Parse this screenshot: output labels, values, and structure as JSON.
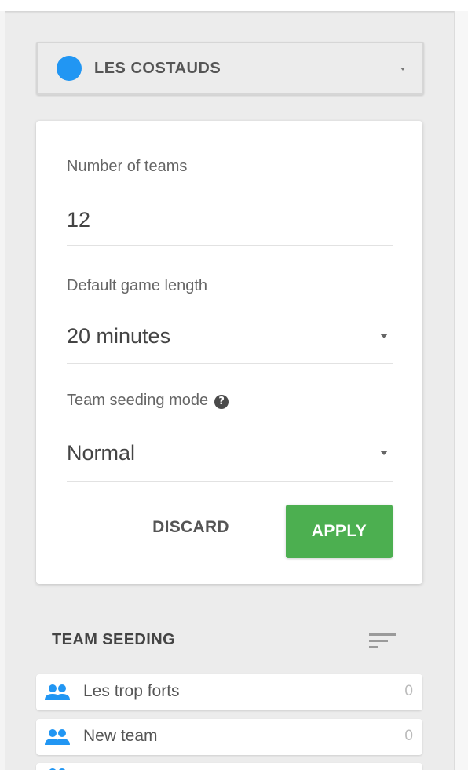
{
  "group_selector": {
    "name": "LES COSTAUDS",
    "color": "#2196f3"
  },
  "settings": {
    "num_teams": {
      "label": "Number of teams",
      "value": "12"
    },
    "game_length": {
      "label": "Default game length",
      "value": "20 minutes"
    },
    "seeding_mode": {
      "label": "Team seeding mode",
      "value": "Normal",
      "help_icon": "help-icon"
    },
    "discard_label": "DISCARD",
    "apply_label": "APPLY",
    "apply_color": "#4caf50"
  },
  "team_seeding": {
    "title": "TEAM SEEDING",
    "sort_icon": "sort-icon",
    "teams": [
      {
        "name": "Les trop forts",
        "score": "0",
        "icon": "people-icon"
      },
      {
        "name": "New team",
        "score": "0",
        "icon": "people-icon"
      }
    ]
  }
}
